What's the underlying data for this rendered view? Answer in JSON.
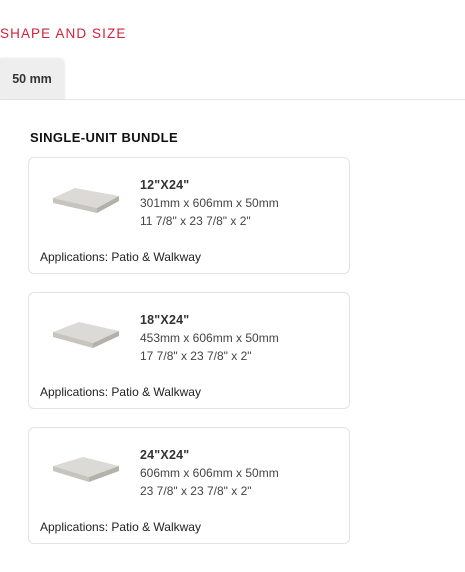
{
  "section": {
    "title": "SHAPE AND SIZE"
  },
  "tabs": [
    {
      "label": "50 mm",
      "selected": true
    }
  ],
  "bundle": {
    "title": "SINGLE-UNIT BUNDLE",
    "cards": [
      {
        "name": "12\"X24\"",
        "metric": "301mm x 606mm x 50mm",
        "imperial": "11 7/8\" x 23 7/8\" x 2\"",
        "applications_label": "Applications:",
        "applications": "Patio & Walkway",
        "icon": "paver-slab-icon"
      },
      {
        "name": "18\"X24\"",
        "metric": "453mm x 606mm x 50mm",
        "imperial": "17 7/8\" x 23 7/8\" x 2\"",
        "applications_label": "Applications:",
        "applications": "Patio & Walkway",
        "icon": "paver-slab-icon"
      },
      {
        "name": "24\"X24\"",
        "metric": "606mm x 606mm x 50mm",
        "imperial": "23 7/8\" x 23 7/8\" x 2\"",
        "applications_label": "Applications:",
        "applications": "Patio & Walkway",
        "icon": "paver-slab-icon"
      }
    ]
  },
  "colors": {
    "accent": "#d1223a",
    "tab_bg": "#eeeeee",
    "card_border": "#e3e3e3",
    "slab_top": "#dcdad6",
    "slab_side": "#b9b6b0"
  }
}
